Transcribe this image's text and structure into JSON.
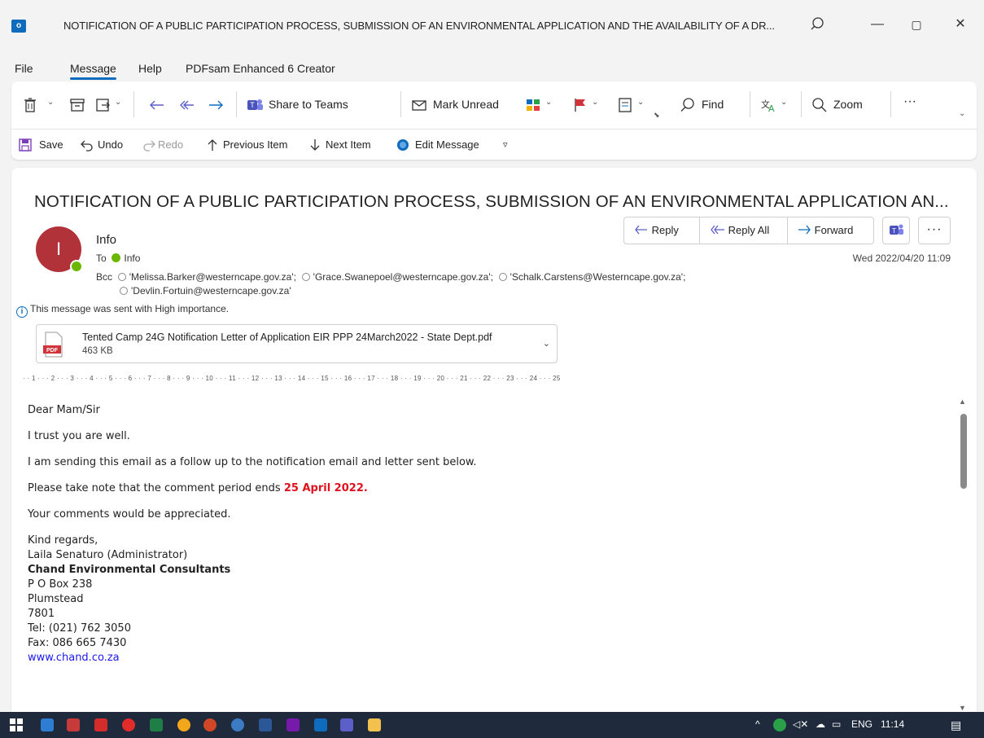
{
  "window": {
    "app_icon_text": "o",
    "title": "NOTIFICATION OF A PUBLIC PARTICIPATION PROCESS, SUBMISSION OF AN ENVIRONMENTAL APPLICATION AND THE AVAILABILITY OF A DR...",
    "min": "—",
    "max": "▢",
    "close": "✕"
  },
  "menu": {
    "file": "File",
    "message": "Message",
    "help": "Help",
    "pdfsam": "PDFsam Enhanced 6 Creator"
  },
  "ribbon": {
    "share_teams": "Share to Teams",
    "mark_unread": "Mark Unread",
    "find": "Find",
    "zoom": "Zoom",
    "more": "···"
  },
  "quick_access": {
    "save": "Save",
    "undo": "Undo",
    "redo": "Redo",
    "previous_item": "Previous Item",
    "next_item": "Next Item",
    "edit_message": "Edit Message"
  },
  "email": {
    "subject": "NOTIFICATION OF A PUBLIC PARTICIPATION PROCESS, SUBMISSION OF AN ENVIRONMENTAL APPLICATION AN...",
    "avatar_initial": "I",
    "sender": "Info",
    "to_label": "To",
    "to_value": "Info",
    "bcc_label": "Bcc",
    "bcc_1": "'Melissa.Barker@westerncape.gov.za';",
    "bcc_2": "'Grace.Swanepoel@westerncape.gov.za';",
    "bcc_3": "'Schalk.Carstens@Westerncape.gov.za';",
    "bcc_4": "'Devlin.Fortuin@westerncape.gov.za'",
    "importance": "This message was sent with High importance.",
    "date": "Wed 2022/04/20 11:09",
    "reply": "Reply",
    "reply_all": "Reply All",
    "forward": "Forward",
    "more": "···"
  },
  "attachment": {
    "name": "Tented Camp 24G Notification Letter of Application EIR PPP 24March2022 - State Dept.pdf",
    "size": "463 KB",
    "type": "PDF"
  },
  "ruler": "· · 1 · · · 2 · · · 3 · · · 4 · · · 5 · · · 6 · · · 7 · · · 8 · · · 9 · · · 10 · · · 11 · · · 12 · · · 13 · · · 14 · · · 15 · · · 16 · · · 17 · · · 18 · · · 19 · · · 20 · · · 21 · · · 22 · · · 23 · · · 24 · · · 25",
  "body": {
    "greeting": "Dear Mam/Sir",
    "line1": "I trust you are well.",
    "line2": "I am sending this email as a follow up to the notification email and letter sent below.",
    "line3_prefix": "Please take note that the comment period ends ",
    "line3_date": "25 April 2022.",
    "line4": "Your comments would be appreciated.",
    "sig_regards": "Kind regards,",
    "sig_name": "Laila Senaturo (Administrator)",
    "sig_company": "Chand Environmental Consultants",
    "sig_box": "P O Box 238",
    "sig_city": "Plumstead",
    "sig_code": "7801",
    "sig_tel": "Tel:  (021) 762 3050",
    "sig_fax": "Fax: 086 665 7430",
    "sig_web": "www.chand.co.za"
  },
  "taskbar": {
    "lang": "ENG",
    "time": "11:14"
  }
}
